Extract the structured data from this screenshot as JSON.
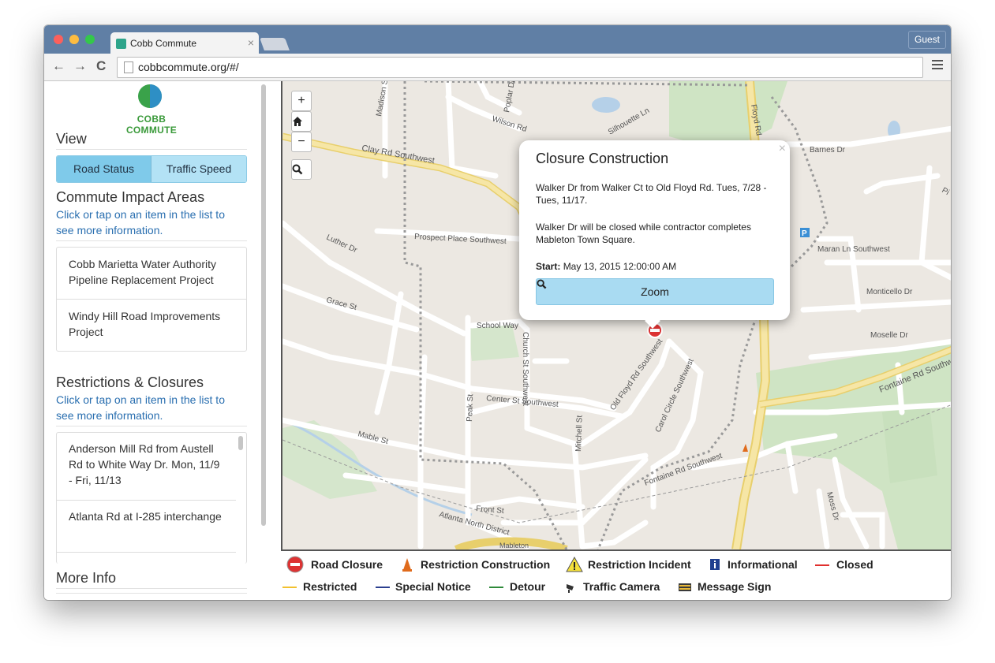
{
  "browser": {
    "tab_title": "Cobb Commute",
    "tab_close": "×",
    "guest_label": "Guest",
    "url": "cobbcommute.org/#/",
    "back": "←",
    "forward": "→",
    "reload": "C"
  },
  "sidebar": {
    "logo_text": "COBB COMMUTE",
    "view_heading": "View",
    "view_buttons": [
      "Road Status",
      "Traffic Speed"
    ],
    "impact_heading": "Commute Impact Areas",
    "impact_sub": "Click or tap on an item in the list to see more information.",
    "impact_items": [
      "Cobb Marietta Water Authority Pipeline Replacement Project",
      "Windy Hill Road Improvements Project"
    ],
    "restrictions_heading": "Restrictions & Closures",
    "restrictions_sub": "Click or tap on an item in the list to see more information.",
    "restriction_items": [
      "Anderson Mill Rd from Austell Rd to White Way Dr. Mon, 11/9 - Fri, 11/13",
      "Atlanta Rd at I-285 interchange"
    ],
    "more_info_heading": "More Info"
  },
  "map": {
    "controls": [
      "+",
      "−",
      "⌕"
    ],
    "labels": [
      "Clay Rd Southwest",
      "Wilson Rd",
      "Silhouette Ln",
      "Floyd Rd",
      "Barnes Dr",
      "Prospect Place Southwest",
      "Luther Dr",
      "Maran Ln Southwest",
      "Grace St",
      "School Way",
      "Church St Southwest",
      "Monticello Dr",
      "Moselle Dr",
      "Center St Southwest",
      "Old Floyd Rd Southwest",
      "Carol Circle Southwest",
      "Fontaine Rd Southwest",
      "Peak St",
      "Mitchell St",
      "Mable St",
      "Fontaine Rd Southwest",
      "Front St",
      "Atlanta North District",
      "Moss Dr",
      "Madison St",
      "Poplar Dr",
      "Mableton",
      "P",
      "Pi"
    ],
    "popup": {
      "close": "×",
      "title": "Closure Construction",
      "line1": "Walker Dr from Walker Ct to Old Floyd Rd. Tues, 7/28 - Tues, 11/17.",
      "line2": "Walker Dr will be closed while contractor completes Mableton Town Square.",
      "start_label": "Start:",
      "start_value": "May 13, 2015 12:00:00 AM",
      "zoom_label": "Zoom"
    }
  },
  "legend": [
    {
      "label": "Road Closure",
      "icon": "road-closure-icon"
    },
    {
      "label": "Restriction Construction",
      "icon": "construction-cone-icon"
    },
    {
      "label": "Restriction Incident",
      "icon": "warning-icon"
    },
    {
      "label": "Informational",
      "icon": "info-icon"
    },
    {
      "label": "Closed",
      "icon": "red-line-icon",
      "color": "#e0302e"
    },
    {
      "label": "Restricted",
      "icon": "yellow-line-icon",
      "color": "#f2c12e"
    },
    {
      "label": "Special Notice",
      "icon": "blue-line-icon",
      "color": "#2b3f8f"
    },
    {
      "label": "Detour",
      "icon": "green-line-icon",
      "color": "#2e8a3a"
    },
    {
      "label": "Traffic Camera",
      "icon": "camera-icon"
    },
    {
      "label": "Message Sign",
      "icon": "message-sign-icon"
    }
  ]
}
